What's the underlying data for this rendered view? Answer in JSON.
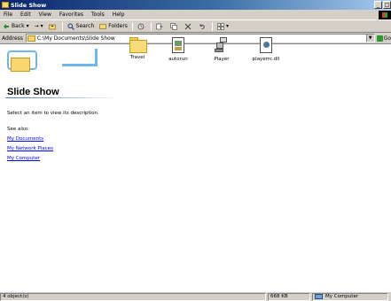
{
  "window": {
    "title": "Slide Show",
    "controls": [
      "_",
      "□",
      "×"
    ]
  },
  "menu": [
    "File",
    "Edit",
    "View",
    "Favorites",
    "Tools",
    "Help"
  ],
  "toolbar": {
    "back": "Back",
    "forward_symbol": "→",
    "search": "Search",
    "folders": "Folders"
  },
  "address": {
    "label": "Address",
    "path": "C:\\My Documents\\Slide Show",
    "go": "Go"
  },
  "left_pane": {
    "title": "Slide Show",
    "description": "Select an item to view its description.",
    "see_also": "See also:",
    "links": [
      "My Documents",
      "My Network Places",
      "My Computer"
    ]
  },
  "files": [
    {
      "name": "Travel",
      "icon": "folder-icon"
    },
    {
      "name": "autorun",
      "icon": "document-icon"
    },
    {
      "name": "Player",
      "icon": "application-icon"
    },
    {
      "name": "playerrc.dll",
      "icon": "dll-icon"
    }
  ],
  "status": {
    "objects": "4 object(s)",
    "size": "668 KB",
    "location": "My Computer"
  }
}
